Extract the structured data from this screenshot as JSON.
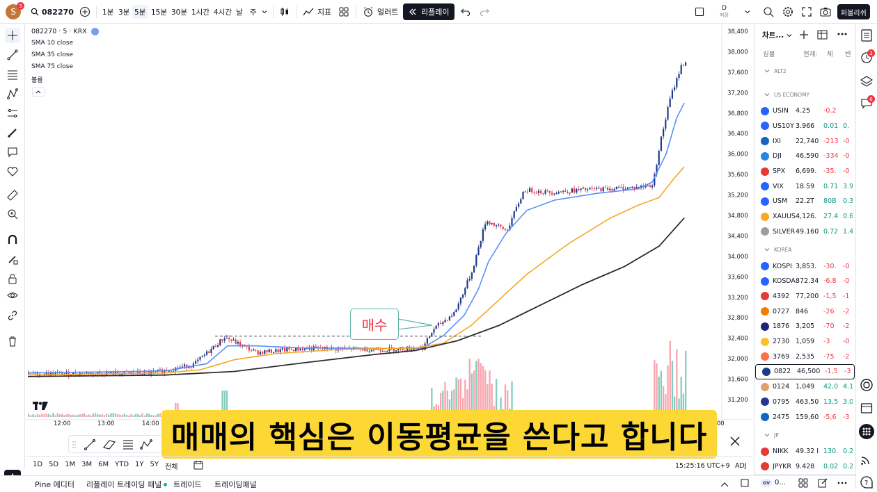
{
  "topbar": {
    "avatar_letter": "S",
    "avatar_badge": "3",
    "symbol": "082270",
    "intervals": [
      "1분",
      "3분",
      "5분",
      "15분",
      "30분",
      "1시간",
      "4시간",
      "날",
      "주"
    ],
    "indicators_label": "지표",
    "alerts_label": "얼러트",
    "replay_label": "리플레이",
    "layout_label": "D",
    "layout_sub": "저장",
    "publish_label": "퍼블리쉬"
  },
  "legend": {
    "title": "082270 · 5 · KRX",
    "sma1": "SMA 10 close",
    "sma2": "SMA 35 close",
    "sma3": "SMA 75 close",
    "volume": "볼륨"
  },
  "annotation": {
    "label": "매수"
  },
  "subtitle": "매매의 핵심은 이동평균을 쓴다고 합니다",
  "price_axis": [
    "38,400",
    "38,000",
    "37,600",
    "37,200",
    "36,800",
    "36,400",
    "36,000",
    "35,600",
    "35,200",
    "34,800",
    "34,400",
    "34,000",
    "33,600",
    "33,200",
    "32,800",
    "32,400",
    "32,000",
    "31,600",
    "31,200"
  ],
  "time_axis": [
    "12:00",
    "13:00",
    "14:00",
    ":00"
  ],
  "bottombar": {
    "ranges": [
      "1D",
      "5D",
      "1M",
      "3M",
      "6M",
      "YTD",
      "1Y",
      "5Y",
      "전체"
    ],
    "clock": "15:25:16 UTC+9",
    "adj": "ADJ"
  },
  "tabs": [
    "Pine 에디터",
    "리플레이 트레이딩 패널",
    "트레이드",
    "트레이딩패널"
  ],
  "watchlist": {
    "title": "차트...",
    "cols": [
      "심볼",
      "현재:",
      "체",
      "변"
    ],
    "sections": [
      {
        "name": "ALT2",
        "rows": []
      },
      {
        "name": "US ECONOMY",
        "rows": [
          {
            "sym": "USIN",
            "last": "4.25",
            "chg": "-0.2",
            "pct": "",
            "color": "#2962ff",
            "dir": "down"
          },
          {
            "sym": "US10Y",
            "last": "3.966",
            "chg": "0.01",
            "pct": "0.",
            "color": "#2962ff",
            "dir": "up"
          },
          {
            "sym": "IXI",
            "last": "22,740",
            "chg": "-213",
            "pct": "-0",
            "color": "#1565c0",
            "dir": "down"
          },
          {
            "sym": "DJI",
            "last": "46,590",
            "chg": "-334",
            "pct": "-0",
            "color": "#1e88e5",
            "dir": "down"
          },
          {
            "sym": "SPX",
            "last": "6,699.",
            "chg": "-35.",
            "pct": "-0",
            "color": "#e53935",
            "dir": "down"
          },
          {
            "sym": "VIX",
            "last": "18.59",
            "chg": "0.71",
            "pct": "3.9",
            "color": "#2962ff",
            "dir": "up"
          },
          {
            "sym": "USM",
            "last": "22.2T",
            "chg": "80B",
            "pct": "0.3",
            "color": "#2962ff",
            "dir": "up"
          },
          {
            "sym": "XAUUS",
            "last": "4,126.",
            "chg": "27.4",
            "pct": "0.6",
            "color": "#f9a825",
            "dir": "up"
          },
          {
            "sym": "SILVER",
            "last": "49.160",
            "chg": "0.72",
            "pct": "1.4",
            "color": "#9e9e9e",
            "dir": "up"
          }
        ]
      },
      {
        "name": "KOREA",
        "rows": [
          {
            "sym": "KOSPI",
            "last": "3,853.",
            "chg": "-30.",
            "pct": "-0",
            "color": "#2962ff",
            "dir": "down"
          },
          {
            "sym": "KOSDA",
            "last": "872.34",
            "chg": "-6.8",
            "pct": "-0",
            "color": "#2962ff",
            "dir": "down"
          },
          {
            "sym": "4392",
            "last": "77,200",
            "chg": "-1,5",
            "pct": "-1",
            "color": "#e53935",
            "dir": "down"
          },
          {
            "sym": "0727",
            "last": "846",
            "chg": "-26",
            "pct": "-2",
            "color": "#f57c00",
            "dir": "down"
          },
          {
            "sym": "1876",
            "last": "3,205",
            "chg": "-70",
            "pct": "-2",
            "color": "#1a237e",
            "dir": "down"
          },
          {
            "sym": "2730",
            "last": "1,059",
            "chg": "-3",
            "pct": "-0",
            "color": "#fbc02d",
            "dir": "down"
          },
          {
            "sym": "3769",
            "last": "2,535",
            "chg": "-75",
            "pct": "-2",
            "color": "#ff7043",
            "dir": "down"
          },
          {
            "sym": "0822",
            "last": "46,500",
            "chg": "-1,5",
            "pct": "-3",
            "color": "#1e3a8a",
            "dir": "down",
            "selected": true
          },
          {
            "sym": "0124",
            "last": "1,049",
            "chg": "42,0",
            "pct": "4.1",
            "color": "#e0a070",
            "dir": "up"
          },
          {
            "sym": "0795",
            "last": "463,50",
            "chg": "13,5",
            "pct": "3.0",
            "color": "#283593",
            "dir": "up"
          },
          {
            "sym": "2475",
            "last": "159,60",
            "chg": "-5,6",
            "pct": "-3",
            "color": "#1565c0",
            "dir": "down"
          }
        ]
      },
      {
        "name": "JP",
        "rows": [
          {
            "sym": "NIKK",
            "last": "49.32 I",
            "chg": "130.",
            "pct": "0.2",
            "color": "#e53935",
            "dir": "up"
          },
          {
            "sym": "JPYKR",
            "last": "9.428",
            "chg": "0.02",
            "pct": "0.2",
            "color": "#e53935",
            "dir": "up"
          }
        ]
      }
    ],
    "footer_sym": "GV",
    "footer_text": "0..."
  },
  "rightstrip_badges": [
    "3",
    "6"
  ]
}
